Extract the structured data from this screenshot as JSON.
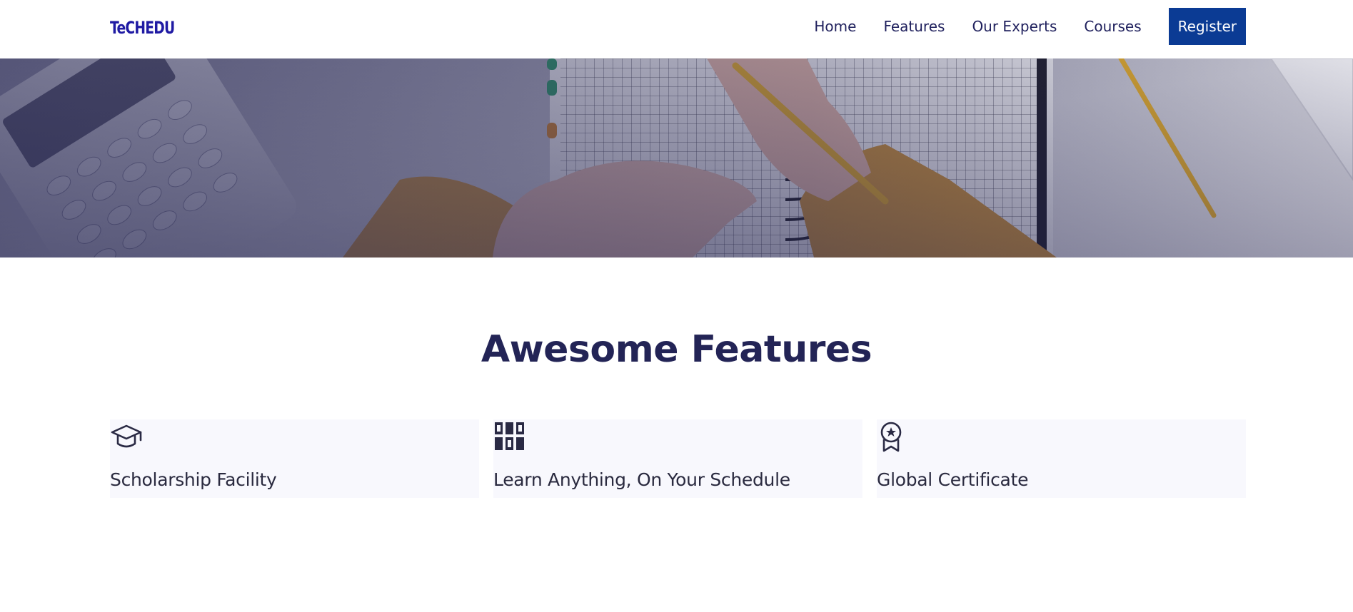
{
  "brand": {
    "logo_text": "TeCHEDU"
  },
  "nav": {
    "links": [
      "Home",
      "Features",
      "Our Experts",
      "Courses"
    ],
    "register_label": "Register"
  },
  "features": {
    "title": "Awesome Features",
    "cards": [
      {
        "icon": "graduation-cap-icon",
        "title": "Scholarship Facility"
      },
      {
        "icon": "grid-blocks-icon",
        "title": "Learn Anything, On Your Schedule"
      },
      {
        "icon": "award-badge-icon",
        "title": "Global Certificate"
      }
    ]
  },
  "colors": {
    "brand": "#1f1aa3",
    "register_bg": "#0b3b94",
    "heading": "#232456",
    "card_bg": "#f8f8fd"
  }
}
